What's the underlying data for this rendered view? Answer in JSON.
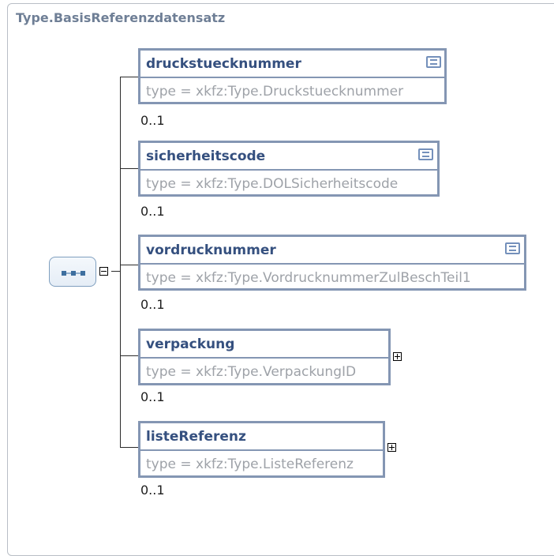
{
  "title": "Type.BasisReferenzdatensatz",
  "sequence": {
    "icon": "sequence-compositor-icon",
    "expanded": true
  },
  "elements": [
    {
      "name": "druckstuecknummer",
      "type": "type = xkfz:Type.Druckstuecknummer",
      "occurs": "0..1",
      "has_documentation": true,
      "expandable": false
    },
    {
      "name": "sicherheitscode",
      "type": "type = xkfz:Type.DOLSicherheitscode",
      "occurs": "0..1",
      "has_documentation": true,
      "expandable": false
    },
    {
      "name": "vordrucknummer",
      "type": "type = xkfz:Type.VordrucknummerZulBeschTeil1",
      "occurs": "0..1",
      "has_documentation": true,
      "expandable": false
    },
    {
      "name": "verpackung",
      "type": "type = xkfz:Type.VerpackungID",
      "occurs": "0..1",
      "has_documentation": false,
      "expandable": true
    },
    {
      "name": "listeReferenz",
      "type": "type = xkfz:Type.ListeReferenz",
      "occurs": "0..1",
      "has_documentation": false,
      "expandable": true
    }
  ]
}
